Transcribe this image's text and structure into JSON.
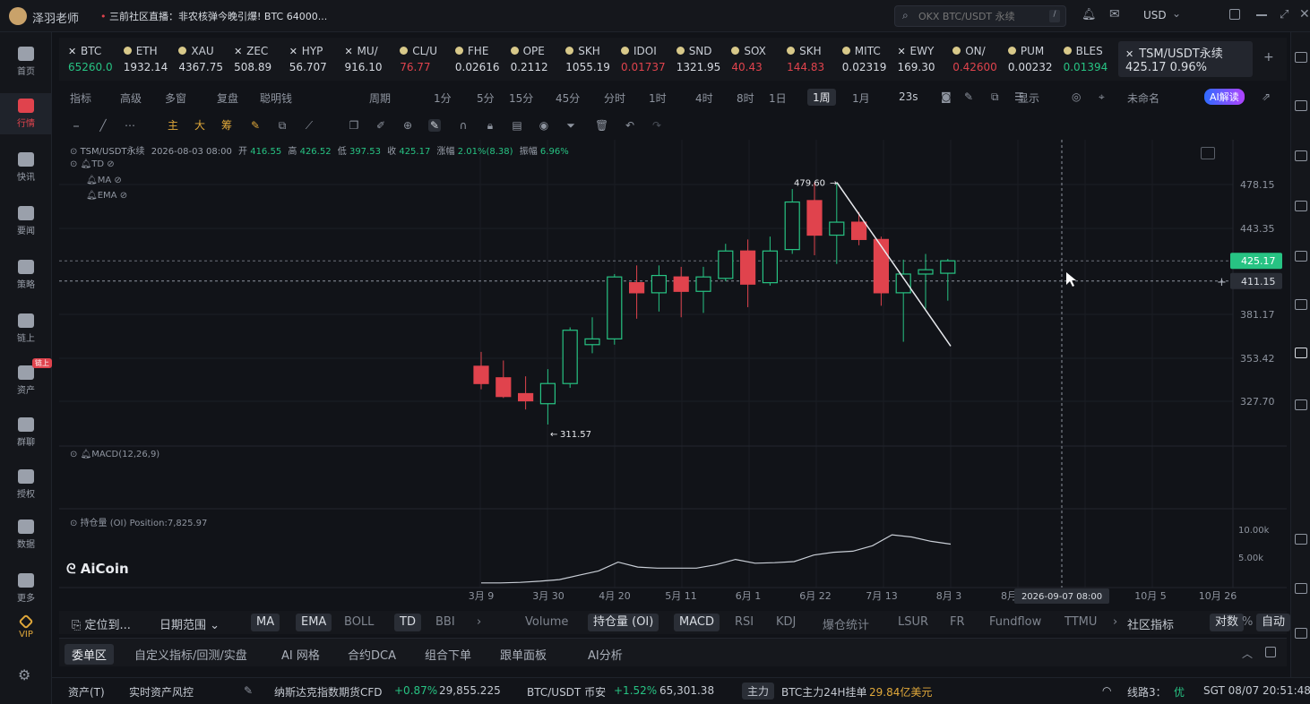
{
  "titlebar": {
    "user": "泽羽老师",
    "news": "三前社区直播：非农核弹今晚引爆! BTC 64000...",
    "search_placeholder": "OKX BTC/USDT 永续",
    "currency": "USD"
  },
  "left_nav": [
    {
      "label": "首页",
      "icon": "home-icon"
    },
    {
      "label": "行情",
      "icon": "chart-bar-icon",
      "active": true
    },
    {
      "label": "快讯",
      "icon": "flash-news-icon"
    },
    {
      "label": "要闻",
      "icon": "document-icon"
    },
    {
      "label": "策略",
      "icon": "robot-icon"
    },
    {
      "label": "链上",
      "icon": "chain-icon"
    },
    {
      "label": "资产",
      "icon": "wallet-icon",
      "badge": "链上"
    },
    {
      "label": "群聊",
      "icon": "chat-icon"
    },
    {
      "label": "授权",
      "icon": "key-icon"
    },
    {
      "label": "数据",
      "icon": "data-icon"
    },
    {
      "label": "更多",
      "icon": "grid-icon"
    },
    {
      "label": "VIP",
      "icon": "vip-icon"
    }
  ],
  "tickers": [
    {
      "name": "BTC",
      "value": "65260.0",
      "color": "green",
      "mark": "x"
    },
    {
      "name": "ETH",
      "value": "1932.14",
      "color": "white",
      "mark": "dot"
    },
    {
      "name": "XAU",
      "value": "4367.75",
      "color": "white",
      "mark": "dot"
    },
    {
      "name": "ZEC",
      "value": "508.89",
      "color": "white",
      "mark": "x"
    },
    {
      "name": "HYP",
      "value": "56.707",
      "color": "white",
      "mark": "x"
    },
    {
      "name": "MU/",
      "value": "916.10",
      "color": "white",
      "mark": "x"
    },
    {
      "name": "CL/U",
      "value": "76.77",
      "color": "red",
      "mark": "dot"
    },
    {
      "name": "FHE",
      "value": "0.02616",
      "color": "white",
      "mark": "dot"
    },
    {
      "name": "OPE",
      "value": "0.2112",
      "color": "white",
      "mark": "dot"
    },
    {
      "name": "SKH",
      "value": "1055.19",
      "color": "white",
      "mark": "dot"
    },
    {
      "name": "IDOI",
      "value": "0.01737",
      "color": "red",
      "mark": "dot"
    },
    {
      "name": "SND",
      "value": "1321.95",
      "color": "white",
      "mark": "dot"
    },
    {
      "name": "SOX",
      "value": "40.43",
      "color": "red",
      "mark": "dot"
    },
    {
      "name": "SKH",
      "value": "144.83",
      "color": "red",
      "mark": "dot"
    },
    {
      "name": "MITC",
      "value": "0.02319",
      "color": "white",
      "mark": "dot"
    },
    {
      "name": "EWY",
      "value": "169.30",
      "color": "white",
      "mark": "x"
    },
    {
      "name": "ON/",
      "value": "0.42600",
      "color": "red",
      "mark": "dot"
    },
    {
      "name": "PUM",
      "value": "0.00232",
      "color": "white",
      "mark": "dot"
    },
    {
      "name": "BLES",
      "value": "0.01394",
      "color": "green",
      "mark": "dot"
    }
  ],
  "active_ticker": {
    "name": "TSM/USDT永续",
    "price": "425.17",
    "change": "0.96%"
  },
  "toolbar1": {
    "items": [
      "指标",
      "高级",
      "多窗",
      "复盘",
      "聪明钱",
      "周期",
      "1分",
      "5分",
      "15分",
      "45分",
      "分时",
      "1时",
      "4时",
      "8时",
      "1日",
      "1周",
      "1月",
      "23s",
      "显示",
      "未命名",
      "AI解读"
    ],
    "active": "1周"
  },
  "toolbar2": {
    "labels": [
      "主",
      "大",
      "筹"
    ]
  },
  "chart_header": {
    "symbol": "TSM/USDT永续",
    "time": "2026-08-03 08:00",
    "open_label": "开",
    "open": "416.55",
    "high_label": "高",
    "high": "426.52",
    "low_label": "低",
    "low": "397.53",
    "close_label": "收",
    "close": "425.17",
    "chg_label": "涨幅",
    "chg": "2.01%(8.38)",
    "amp_label": "振幅",
    "amp": "6.96%",
    "ind1": "TD",
    "ind2": "MA",
    "ind3": "EMA",
    "macd": "MACD(12,26,9)",
    "oi_label": "持仓量 (OI)",
    "oi_position": "Position:7,825.97",
    "watermark": "AiCoin"
  },
  "chart_data": {
    "type": "candlestick",
    "price_axis_ticks": [
      "478.15",
      "443.35",
      "381.17",
      "353.42",
      "327.70"
    ],
    "current_price_label": "425.17",
    "crosshair_price_label": "411.15",
    "crosshair_date_label": "2026-09-07 08:00",
    "x_tick_labels": [
      "3月 9",
      "3月 30",
      "4月 20",
      "5月 11",
      "6月 1",
      "6月 22",
      "7月 13",
      "8月 3",
      "8月",
      "10月 5",
      "10月 26"
    ],
    "annot_high": "479.60",
    "annot_low": "311.57",
    "oi_axis_ticks": [
      "10.00k",
      "5.00k"
    ],
    "ylim": [
      300,
      500
    ],
    "candles": [
      {
        "o": 352,
        "h": 362,
        "l": 336,
        "c": 340
      },
      {
        "o": 344,
        "h": 356,
        "l": 330,
        "c": 331
      },
      {
        "o": 333,
        "h": 345,
        "l": 322,
        "c": 328
      },
      {
        "o": 326,
        "h": 350,
        "l": 311.57,
        "c": 340
      },
      {
        "o": 340,
        "h": 379,
        "l": 337,
        "c": 377
      },
      {
        "o": 367,
        "h": 386,
        "l": 361,
        "c": 371
      },
      {
        "o": 371,
        "h": 416,
        "l": 367,
        "c": 414
      },
      {
        "o": 410,
        "h": 422,
        "l": 385,
        "c": 403
      },
      {
        "o": 403,
        "h": 422,
        "l": 390,
        "c": 415
      },
      {
        "o": 414,
        "h": 421,
        "l": 386,
        "c": 404
      },
      {
        "o": 404,
        "h": 421,
        "l": 389,
        "c": 414
      },
      {
        "o": 413,
        "h": 437,
        "l": 411,
        "c": 432
      },
      {
        "o": 432,
        "h": 440,
        "l": 393,
        "c": 409
      },
      {
        "o": 410,
        "h": 442,
        "l": 408,
        "c": 432
      },
      {
        "o": 433,
        "h": 475,
        "l": 430,
        "c": 466
      },
      {
        "o": 467,
        "h": 479.6,
        "l": 429,
        "c": 443
      },
      {
        "o": 443,
        "h": 479,
        "l": 423,
        "c": 452
      },
      {
        "o": 452,
        "h": 459,
        "l": 436,
        "c": 440
      },
      {
        "o": 440,
        "h": 442,
        "l": 394,
        "c": 403
      },
      {
        "o": 403,
        "h": 426,
        "l": 369,
        "c": 416
      },
      {
        "o": 416,
        "h": 430,
        "l": 392,
        "c": 419
      },
      {
        "o": 416.55,
        "h": 426.52,
        "l": 397.53,
        "c": 425.17
      }
    ],
    "oi_series": [
      0.2,
      0.2,
      0.3,
      0.5,
      0.8,
      1.6,
      2.4,
      4.0,
      3.1,
      2.9,
      2.9,
      2.9,
      3.5,
      4.5,
      3.8,
      3.9,
      4.1,
      5.3,
      5.8,
      6.0,
      7.0,
      9.0,
      8.6,
      7.8,
      7.3
    ]
  },
  "bottom_bar": {
    "locate": "定位到...",
    "date_range": "日期范围",
    "items": [
      "MA",
      "EMA",
      "BOLL",
      "TD",
      "BBI",
      "Volume",
      "持仓量 (OI)",
      "MACD",
      "RSI",
      "KDJ",
      "爆仓统计",
      "LSUR",
      "FR",
      "Fundflow",
      "TTMU",
      "社区指标",
      "对数",
      "%",
      "自动"
    ],
    "on": [
      "MA",
      "EMA",
      "TD",
      "持仓量 (OI)",
      "MACD",
      "对数",
      "自动"
    ]
  },
  "tabs": [
    "委单区",
    "自定义指标/回测/实盘",
    "AI 网格",
    "合约DCA",
    "组合下单",
    "跟单面板",
    "AI分析"
  ],
  "status_bar": {
    "assets": "资产(T)",
    "risk": "实时资产风控",
    "nasdaq": "纳斯达克指数期货CFD",
    "nasdaq_chg": "+0.87%",
    "nasdaq_val": "29,855.225",
    "btc": "BTC/USDT 币安",
    "btc_chg": "+1.52%",
    "btc_val": "65,301.38",
    "main_label": "主力",
    "btc_main": "BTC主力24H挂单",
    "btc_main_val": "29.84亿美元",
    "line": "线路3：",
    "line_q": "优",
    "time": "SGT 08/07 20:51:48"
  },
  "colors": {
    "up": "#27c383",
    "down": "#e0434d",
    "bg": "#111318",
    "accent": "#2f6bff"
  }
}
